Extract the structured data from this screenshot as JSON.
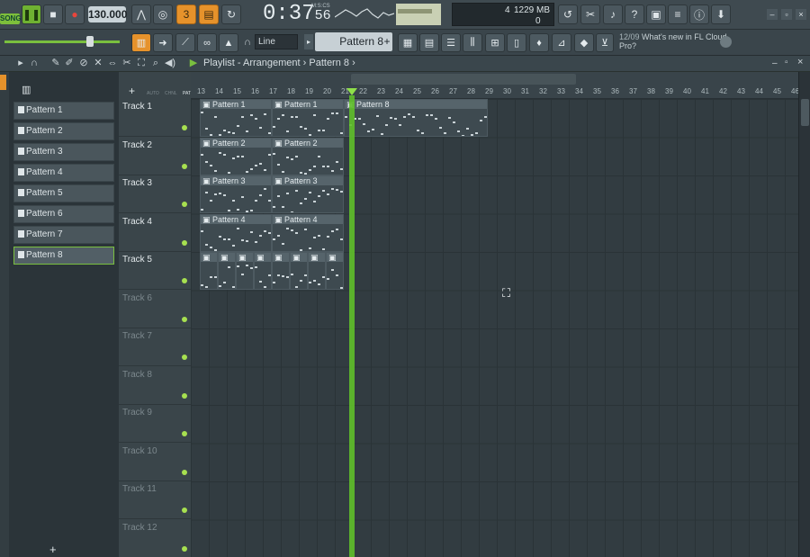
{
  "transport": {
    "mode_label": "SONG",
    "bpm": "130.000",
    "time": "0:37",
    "time_sub": "56",
    "time_unit": "M:S:CS",
    "polyphony": "4",
    "memory": "1229 MB",
    "cpu_zero": "0",
    "cpu_fraction": 0.82
  },
  "toolbar2": {
    "snap_mode": "Line",
    "pattern_selector": "Pattern 8",
    "news_date": "12/09",
    "news_text": "What's new in FL Cloud Pro?"
  },
  "playlist": {
    "breadcrumb": "Playlist - Arrangement › Pattern 8 ›",
    "header_labels": [
      "AUTO",
      "CHNL",
      "PAT"
    ]
  },
  "patterns": [
    "Pattern 1",
    "Pattern 2",
    "Pattern 3",
    "Pattern 4",
    "Pattern 5",
    "Pattern 6",
    "Pattern 7",
    "Pattern 8"
  ],
  "selected_pattern": "Pattern 8",
  "tracks": [
    "Track 1",
    "Track 2",
    "Track 3",
    "Track 4",
    "Track 5",
    "Track 6",
    "Track 7",
    "Track 8",
    "Track 9",
    "Track 10",
    "Track 11",
    "Track 12"
  ],
  "ruler": [
    "13",
    "14",
    "15",
    "16",
    "17",
    "18",
    "19",
    "20",
    "21",
    "22",
    "23",
    "24",
    "25",
    "26",
    "27",
    "28",
    "29",
    "30",
    "31",
    "32",
    "33",
    "34",
    "35",
    "36",
    "37",
    "38",
    "39",
    "40",
    "41",
    "42",
    "43",
    "44",
    "45",
    "46"
  ],
  "clips": [
    {
      "track": 0,
      "start": 13,
      "len": 4,
      "label": "Pattern 1"
    },
    {
      "track": 0,
      "start": 17,
      "len": 4,
      "label": "Pattern 1"
    },
    {
      "track": 0,
      "start": 21,
      "len": 8,
      "label": "Pattern 8"
    },
    {
      "track": 1,
      "start": 13,
      "len": 4,
      "label": "Pattern 2"
    },
    {
      "track": 1,
      "start": 17,
      "len": 4,
      "label": "Pattern 2"
    },
    {
      "track": 2,
      "start": 13,
      "len": 4,
      "label": "Pattern 3"
    },
    {
      "track": 2,
      "start": 17,
      "len": 4,
      "label": "Pattern 3"
    },
    {
      "track": 3,
      "start": 13,
      "len": 4,
      "label": "Pattern 4"
    },
    {
      "track": 3,
      "start": 17,
      "len": 4,
      "label": "Pattern 4"
    },
    {
      "track": 4,
      "start": 13,
      "len": 1,
      "label": ""
    },
    {
      "track": 4,
      "start": 14,
      "len": 1,
      "label": ""
    },
    {
      "track": 4,
      "start": 15,
      "len": 1,
      "label": ""
    },
    {
      "track": 4,
      "start": 16,
      "len": 1,
      "label": ""
    },
    {
      "track": 4,
      "start": 17,
      "len": 1,
      "label": ""
    },
    {
      "track": 4,
      "start": 18,
      "len": 1,
      "label": ""
    },
    {
      "track": 4,
      "start": 19,
      "len": 1,
      "label": ""
    },
    {
      "track": 4,
      "start": 20,
      "len": 1,
      "label": ""
    }
  ],
  "playhead_bar": 21.3,
  "icons": {
    "play": "pause-icon",
    "stop": "stop-icon",
    "record": "record-icon",
    "magnet": "magnet-icon",
    "pencil": "pencil-icon",
    "brush": "brush-icon"
  }
}
